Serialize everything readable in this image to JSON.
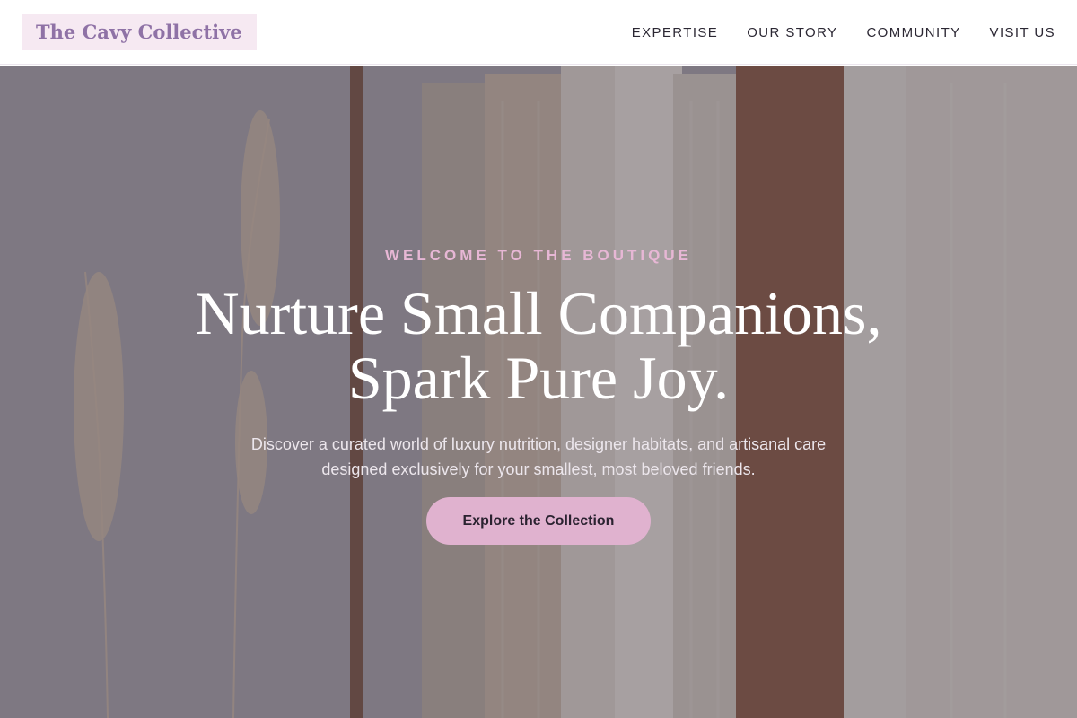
{
  "brand": {
    "name": "The Cavy Collective"
  },
  "nav": {
    "items": [
      {
        "label": "EXPERTISE"
      },
      {
        "label": "OUR STORY"
      },
      {
        "label": "COMMUNITY"
      },
      {
        "label": "VISIT US"
      }
    ]
  },
  "hero": {
    "eyebrow": "WELCOME TO THE BOUTIQUE",
    "headline_line1": "Nurture Small Companions,",
    "headline_line2": "Spark Pure Joy.",
    "subtext": "Discover a curated world of luxury nutrition, designer habitats, and artisanal care designed exclusively for your smallest, most beloved friends.",
    "cta_label": "Explore the Collection"
  },
  "colors": {
    "logo_text": "#8f72a6",
    "logo_bg": "#f6e9f2",
    "eyebrow": "#e7b7d5",
    "cta_bg": "#e0b2cf"
  }
}
